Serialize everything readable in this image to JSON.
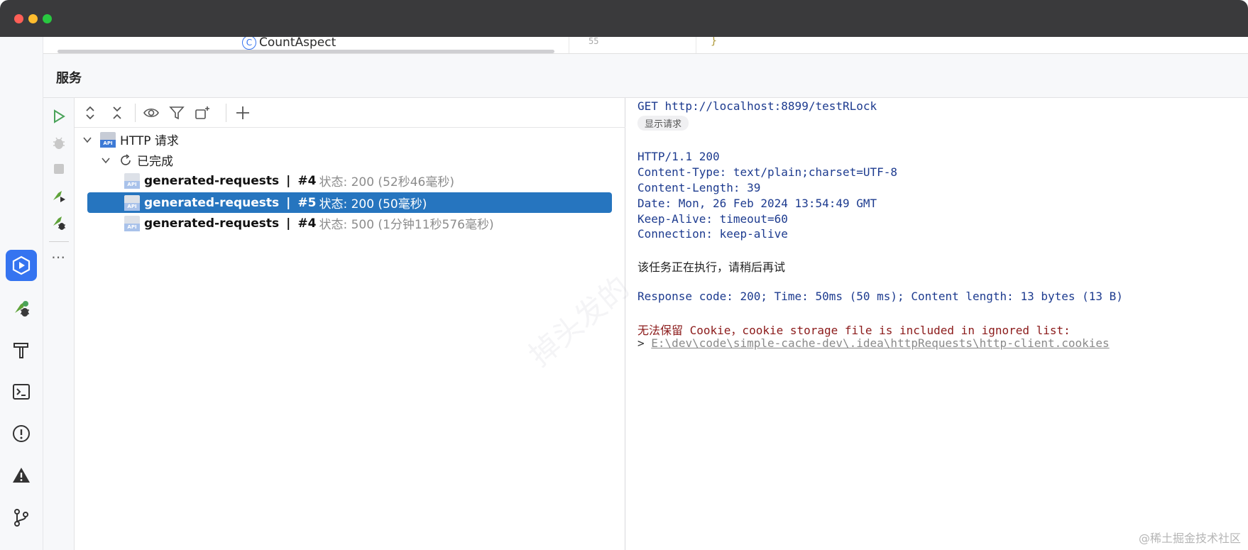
{
  "editor_peek": {
    "class_icon": "C",
    "class_name": "CountAspect",
    "line_number": "55",
    "code_snippet": "}"
  },
  "panel": {
    "title": "服务"
  },
  "tree": {
    "root_label": "HTTP 请求",
    "group_label": "已完成",
    "api_icon_text": "API",
    "items": [
      {
        "name": "generated-requests",
        "separator": "|",
        "num": "#4",
        "status": "状态: 200 (52秒46毫秒)",
        "selected": false
      },
      {
        "name": "generated-requests",
        "separator": "|",
        "num": "#5",
        "status": "状态: 200 (50毫秒)",
        "selected": true
      },
      {
        "name": "generated-requests",
        "separator": "|",
        "num": "#4",
        "status": "状态: 500 (1分钟11秒576毫秒)",
        "selected": false
      }
    ]
  },
  "response": {
    "request_line": "GET http://localhost:8899/testRLock",
    "show_request": "显示请求",
    "headers": [
      "HTTP/1.1 200",
      "Content-Type: text/plain;charset=UTF-8",
      "Content-Length: 39",
      "Date: Mon, 26 Feb 2024 13:54:49 GMT",
      "Keep-Alive: timeout=60",
      "Connection: keep-alive"
    ],
    "body": "该任务正在执行，请稍后再试",
    "summary": "Response code: 200; Time: 50ms (50 ms); Content length: 13 bytes (13 B)",
    "cookie_warning": "无法保留 Cookie，cookie storage file is included in ignored list:",
    "cookie_prefix": ">",
    "cookie_path": "E:\\dev\\code\\simple-cache-dev\\.idea\\httpRequests\\http-client.cookies"
  },
  "watermark": "掉头发的",
  "site_mark": "@稀土掘金技术社区",
  "colors": {
    "accent": "#3574f0",
    "selection": "#2675bf",
    "response_text": "#1d3b8f",
    "warning": "#8b1a1a",
    "run_green": "#4aa35a"
  }
}
